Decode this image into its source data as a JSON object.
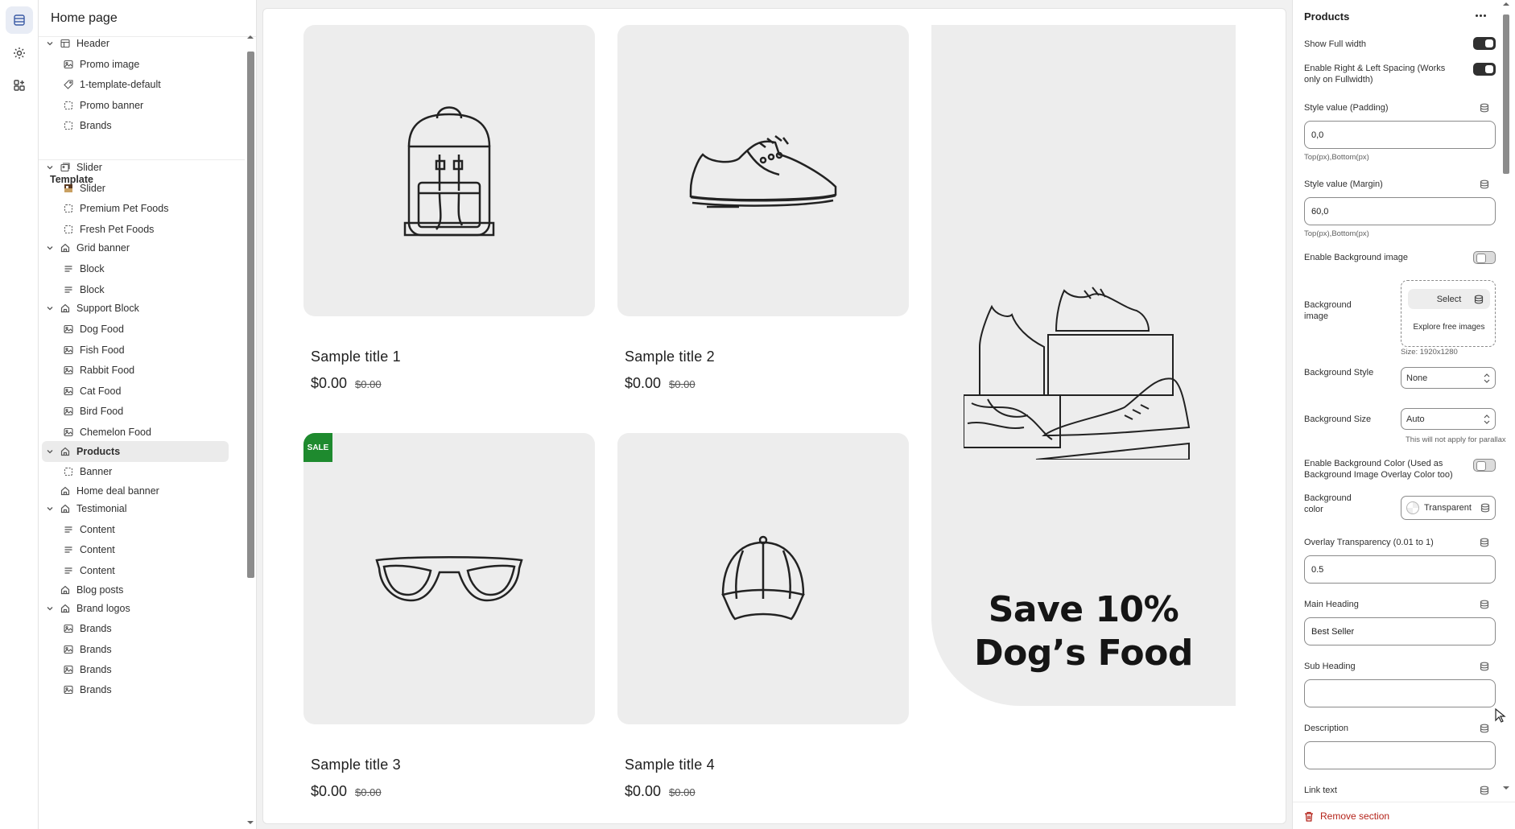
{
  "rail": {
    "items": [
      {
        "name": "sections-icon",
        "active": true
      },
      {
        "name": "settings-gear-icon",
        "active": false
      },
      {
        "name": "apps-icon",
        "active": false
      }
    ]
  },
  "tree": {
    "page_title": "Home page",
    "header_group": [
      {
        "label": "Header",
        "level": 0,
        "icon": "layout-icon",
        "expanded": true
      },
      {
        "label": "Promo image",
        "level": 1,
        "icon": "image-icon"
      },
      {
        "label": "1-template-default",
        "level": 1,
        "icon": "tag-icon"
      },
      {
        "label": "Promo banner",
        "level": 1,
        "icon": "dashed-square-icon"
      },
      {
        "label": "Brands",
        "level": 1,
        "icon": "dashed-square-icon"
      }
    ],
    "template_label": "Template",
    "template_items": [
      {
        "label": "Slider",
        "level": 0,
        "icon": "image-stack-icon",
        "expanded": true
      },
      {
        "label": "Slider",
        "level": 1,
        "icon": "thumbnail-icon"
      },
      {
        "label": "Premium Pet Foods",
        "level": 1,
        "icon": "dashed-square-icon"
      },
      {
        "label": "Fresh Pet Foods",
        "level": 1,
        "icon": "dashed-square-icon"
      },
      {
        "label": "Grid banner",
        "level": 0,
        "icon": "home-icon",
        "expanded": true
      },
      {
        "label": "Block",
        "level": 1,
        "icon": "text-lines-icon"
      },
      {
        "label": "Block",
        "level": 1,
        "icon": "text-lines-icon"
      },
      {
        "label": "Support Block",
        "level": 0,
        "icon": "home-icon",
        "expanded": true
      },
      {
        "label": "Dog Food",
        "level": 1,
        "icon": "image-icon"
      },
      {
        "label": "Fish Food",
        "level": 1,
        "icon": "image-icon"
      },
      {
        "label": "Rabbit Food",
        "level": 1,
        "icon": "image-icon"
      },
      {
        "label": "Cat Food",
        "level": 1,
        "icon": "image-icon"
      },
      {
        "label": "Bird Food",
        "level": 1,
        "icon": "image-icon"
      },
      {
        "label": "Chemelon Food",
        "level": 1,
        "icon": "image-icon"
      },
      {
        "label": "Products",
        "level": 0,
        "icon": "home-icon",
        "expanded": true,
        "selected": true
      },
      {
        "label": "Banner",
        "level": 1,
        "icon": "dashed-square-icon"
      },
      {
        "label": "Home deal banner",
        "level": 0,
        "icon": "home-icon",
        "expanded": false
      },
      {
        "label": "Testimonial",
        "level": 0,
        "icon": "home-icon",
        "expanded": true
      },
      {
        "label": "Content",
        "level": 1,
        "icon": "text-lines-icon"
      },
      {
        "label": "Content",
        "level": 1,
        "icon": "text-lines-icon"
      },
      {
        "label": "Content",
        "level": 1,
        "icon": "text-lines-icon"
      },
      {
        "label": "Blog posts",
        "level": 0,
        "icon": "home-icon",
        "expanded": false
      },
      {
        "label": "Brand logos",
        "level": 0,
        "icon": "home-icon",
        "expanded": true
      },
      {
        "label": "Brands",
        "level": 1,
        "icon": "image-icon"
      },
      {
        "label": "Brands",
        "level": 1,
        "icon": "image-icon"
      },
      {
        "label": "Brands",
        "level": 1,
        "icon": "image-icon"
      },
      {
        "label": "Brands",
        "level": 1,
        "icon": "image-icon"
      }
    ]
  },
  "preview": {
    "products": [
      {
        "title": "Sample title 1",
        "price": "$0.00",
        "compare_price": "$0.00",
        "image": "backpack-icon",
        "sale": false
      },
      {
        "title": "Sample title 2",
        "price": "$0.00",
        "compare_price": "$0.00",
        "image": "sneaker-icon",
        "sale": false
      },
      {
        "title": "Sample title 3",
        "price": "$0.00",
        "compare_price": "$0.00",
        "image": "sunglasses-icon",
        "sale": true
      },
      {
        "title": "Sample title 4",
        "price": "$0.00",
        "compare_price": "$0.00",
        "image": "cap-icon",
        "sale": false
      }
    ],
    "sale_badge": "SALE",
    "banner": {
      "line1": "Save 10%",
      "line2": "Dog’s Food",
      "image": "shoes-stack-icon"
    }
  },
  "settings": {
    "title": "Products",
    "show_full_width": {
      "label": "Show Full width",
      "on": true
    },
    "enable_spacing": {
      "label": "Enable Right & Left Spacing (Works only on Fullwidth)",
      "on": true
    },
    "padding": {
      "label": "Style value (Padding)",
      "value": "0,0",
      "hint": "Top(px),Bottom(px)"
    },
    "margin": {
      "label": "Style value (Margin)",
      "value": "60,0",
      "hint": "Top(px),Bottom(px)"
    },
    "enable_bg_image": {
      "label": "Enable Background image",
      "on": false
    },
    "bg_image": {
      "label": "Background image",
      "select_label": "Select",
      "explore_label": "Explore free images",
      "size_hint": "Size: 1920x1280"
    },
    "bg_style": {
      "label": "Background Style",
      "value": "None"
    },
    "bg_size": {
      "label": "Background Size",
      "value": "Auto",
      "hint": "This will not apply for parallax"
    },
    "enable_bg_color": {
      "label": "Enable Background Color (Used as Background Image Overlay Color too)",
      "on": false
    },
    "bg_color": {
      "label": "Background color",
      "value": "Transparent"
    },
    "overlay": {
      "label": "Overlay Transparency (0.01 to 1)",
      "value": "0.5"
    },
    "main_heading": {
      "label": "Main Heading",
      "value": "Best Seller"
    },
    "sub_heading": {
      "label": "Sub Heading",
      "value": ""
    },
    "description": {
      "label": "Description",
      "value": ""
    },
    "link_text": {
      "label": "Link text"
    },
    "remove_label": "Remove section"
  },
  "colors": {
    "accent_orange": "#f46a36",
    "sale_green": "#1e8a2e",
    "danger": "#b4231a"
  }
}
